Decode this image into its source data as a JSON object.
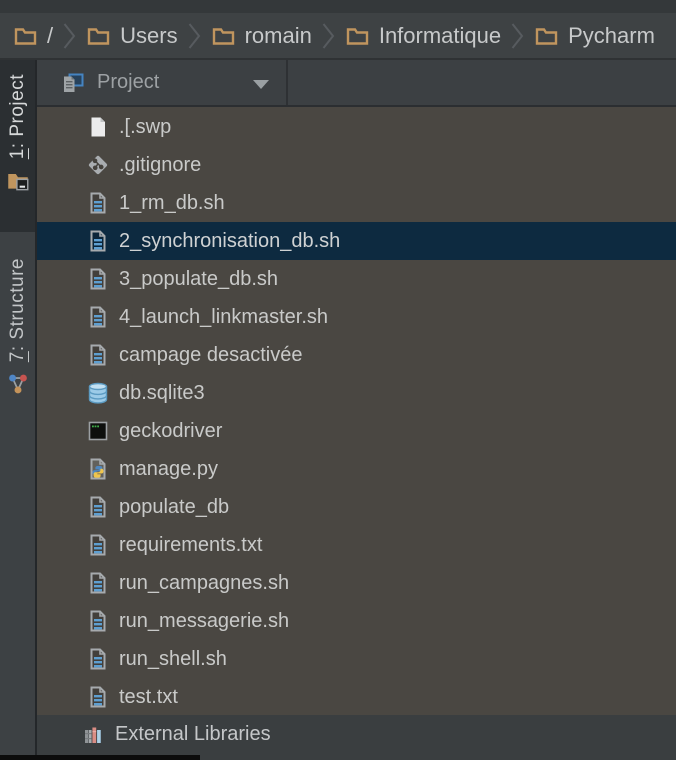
{
  "breadcrumbs": {
    "items": [
      {
        "label": "/"
      },
      {
        "label": "Users"
      },
      {
        "label": "romain"
      },
      {
        "label": "Informatique"
      },
      {
        "label": "Pycharm"
      }
    ]
  },
  "tool_window": {
    "title": "Project"
  },
  "sidebar": {
    "tabs": [
      {
        "mnemonic": "1",
        "rest": ": Project",
        "icon": "project-folder-icon",
        "slug": "project",
        "active": true
      },
      {
        "mnemonic": "7",
        "rest": ": Structure",
        "icon": "structure-icon",
        "slug": "structure",
        "active": false
      }
    ]
  },
  "tree": {
    "items": [
      {
        "label": ".[.swp",
        "icon": "plain-file-icon",
        "selected": false
      },
      {
        "label": ".gitignore",
        "icon": "git-file-icon",
        "selected": false
      },
      {
        "label": "1_rm_db.sh",
        "icon": "text-file-icon",
        "selected": false
      },
      {
        "label": "2_synchronisation_db.sh",
        "icon": "text-file-icon",
        "selected": true
      },
      {
        "label": "3_populate_db.sh",
        "icon": "text-file-icon",
        "selected": false
      },
      {
        "label": "4_launch_linkmaster.sh",
        "icon": "text-file-icon",
        "selected": false
      },
      {
        "label": "campage desactivée",
        "icon": "text-file-icon",
        "selected": false
      },
      {
        "label": "db.sqlite3",
        "icon": "database-icon",
        "selected": false
      },
      {
        "label": "geckodriver",
        "icon": "terminal-icon",
        "selected": false
      },
      {
        "label": "manage.py",
        "icon": "python-file-icon",
        "selected": false
      },
      {
        "label": "populate_db",
        "icon": "text-file-icon",
        "selected": false
      },
      {
        "label": "requirements.txt",
        "icon": "text-file-icon",
        "selected": false
      },
      {
        "label": "run_campagnes.sh",
        "icon": "text-file-icon",
        "selected": false
      },
      {
        "label": "run_messagerie.sh",
        "icon": "text-file-icon",
        "selected": false
      },
      {
        "label": "run_shell.sh",
        "icon": "text-file-icon",
        "selected": false
      },
      {
        "label": "test.txt",
        "icon": "text-file-icon",
        "selected": false
      }
    ]
  },
  "external_libraries": {
    "label": "External Libraries",
    "icon": "library-books-icon"
  },
  "colors": {
    "selection_background": "#0d2a40",
    "tree_background": "#4a4742",
    "panel_background": "#3c4043",
    "breadcrumb_folder": "#c0955e",
    "text": "#c8cac9"
  }
}
